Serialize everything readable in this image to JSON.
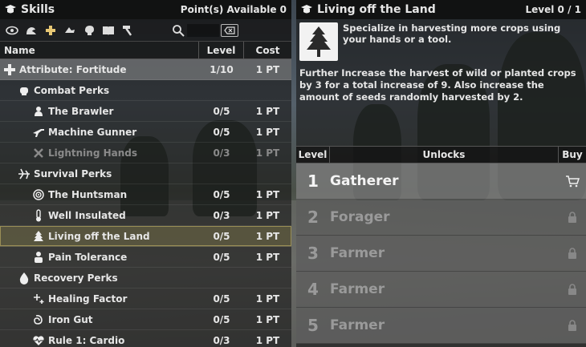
{
  "skills": {
    "title": "Skills",
    "points_available": "Point(s) Available 0",
    "toolbar": [
      "eye-icon",
      "strength-icon",
      "fortitude-icon",
      "agility-icon",
      "intellect-icon",
      "book-icon",
      "hammer-icon"
    ],
    "search_placeholder": "",
    "columns": {
      "name": "Name",
      "level": "Level",
      "cost": "Cost"
    },
    "rows": [
      {
        "type": "attr",
        "icon": "cross-icon",
        "name": "Attribute: Fortitude",
        "level": "1/10",
        "cost": "1 PT"
      },
      {
        "type": "group",
        "icon": "fist-icon",
        "name": "Combat Perks",
        "level": "",
        "cost": ""
      },
      {
        "type": "perk",
        "icon": "brawler-icon",
        "name": "The Brawler",
        "level": "0/5",
        "cost": "1 PT"
      },
      {
        "type": "perk",
        "icon": "gun-icon",
        "name": "Machine Gunner",
        "level": "0/5",
        "cost": "1 PT"
      },
      {
        "type": "perk",
        "icon": "crossed-fists-icon",
        "name": "Lightning Hands",
        "level": "0/3",
        "cost": "1 PT"
      },
      {
        "type": "group",
        "icon": "survival-icon",
        "name": "Survival Perks",
        "level": "",
        "cost": ""
      },
      {
        "type": "perk",
        "icon": "target-icon",
        "name": "The Huntsman",
        "level": "0/5",
        "cost": "1 PT"
      },
      {
        "type": "perk",
        "icon": "thermometer-icon",
        "name": "Well Insulated",
        "level": "0/3",
        "cost": "1 PT"
      },
      {
        "type": "perk",
        "icon": "tree-icon",
        "name": "Living off the Land",
        "level": "0/5",
        "cost": "1 PT"
      },
      {
        "type": "perk",
        "icon": "bandage-icon",
        "name": "Pain Tolerance",
        "level": "0/5",
        "cost": "1 PT"
      },
      {
        "type": "group",
        "icon": "drop-icon",
        "name": "Recovery Perks",
        "level": "",
        "cost": ""
      },
      {
        "type": "perk",
        "icon": "sparkle-icon",
        "name": "Healing Factor",
        "level": "0/5",
        "cost": "1 PT"
      },
      {
        "type": "perk",
        "icon": "gut-icon",
        "name": "Iron Gut",
        "level": "0/5",
        "cost": "1 PT"
      },
      {
        "type": "perk",
        "icon": "heart-icon",
        "name": "Rule 1: Cardio",
        "level": "0/3",
        "cost": "1 PT"
      }
    ]
  },
  "detail": {
    "title": "Living off the Land",
    "level": "Level 0 / 1",
    "image_icon": "pine-tree-icon",
    "short_desc": "Specialize in harvesting more crops using your hands or a tool.",
    "long_desc": "Further Increase the harvest of wild or planted crops by 3 for a total increase of 9. Also increase the amount of seeds randomly harvested by 2.",
    "columns": {
      "level": "Level",
      "unlocks": "Unlocks",
      "buy": "Buy"
    },
    "unlocks": [
      {
        "num": "1",
        "name": "Gatherer",
        "icon": "cart-icon",
        "active": true
      },
      {
        "num": "2",
        "name": "Forager",
        "icon": "lock-icon",
        "active": false
      },
      {
        "num": "3",
        "name": "Farmer",
        "icon": "lock-icon",
        "active": false
      },
      {
        "num": "4",
        "name": "Farmer",
        "icon": "lock-icon",
        "active": false
      },
      {
        "num": "5",
        "name": "Farmer",
        "icon": "lock-icon",
        "active": false
      }
    ]
  },
  "colors": {
    "accent": "#e7c774",
    "panel": "#181818",
    "selected": "#968c50"
  }
}
